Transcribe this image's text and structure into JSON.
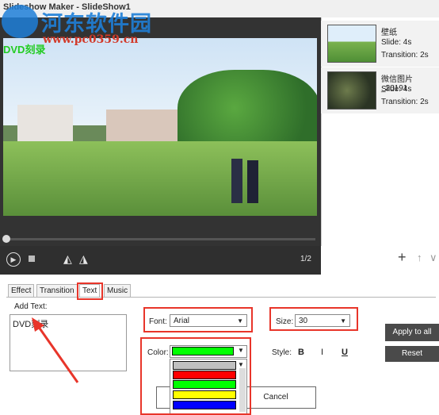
{
  "window": {
    "title": "Slideshow Maker  -  SlideShow1"
  },
  "watermark": {
    "site_name": "河东软件园",
    "url": "www.pc0359.cn",
    "overlay_text": "DVD刻录"
  },
  "player": {
    "page_indicator": "1/2",
    "progress": 0.0
  },
  "thumbnails": [
    {
      "name": "壁纸",
      "slide": "Slide: 4s",
      "transition": "Transition: 2s"
    },
    {
      "name": "微信图片_20191",
      "slide": "Slide: 4s",
      "transition": "Transition: 2s"
    }
  ],
  "tabs": [
    {
      "label": "Effect"
    },
    {
      "label": "Transition"
    },
    {
      "label": "Text",
      "active": true
    },
    {
      "label": "Music"
    }
  ],
  "text_panel": {
    "add_text_label": "Add Text:",
    "text_value": "DVD刻录",
    "font_label": "Font:",
    "font_value": "Arial",
    "size_label": "Size:",
    "size_value": "30",
    "color_label": "Color:",
    "color_value": "#00ff00",
    "style_label": "Style:",
    "bold_label": "B",
    "italic_label": "I",
    "underline_label": "U",
    "apply_label": "Apply to all",
    "reset_label": "Reset"
  },
  "color_options": [
    "#c0c0c0",
    "#ff0000",
    "#00ff00",
    "#ffff00",
    "#0000ff"
  ],
  "dialog": {
    "cancel_label": "Cancel"
  },
  "colors": {
    "annotation": "#e8352a",
    "dark_panel": "#333333",
    "button_dark": "#4a4a4a"
  }
}
